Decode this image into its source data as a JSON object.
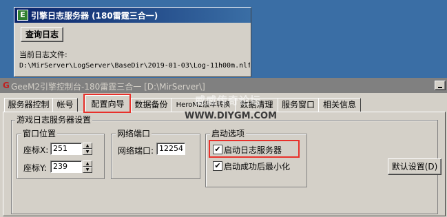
{
  "log_window": {
    "title": "引擎日志服务器 (180雷霆三合一)",
    "icon_letter": "E",
    "query_button": "查询日志",
    "current_file_label": "当前日志文件:",
    "current_file_path": "D:\\MirServer\\LogServer\\BaseDir\\2019-01-03\\Log-11h00m.nlf"
  },
  "main_window": {
    "title": "GeeM2引擎控制台-180雷霆三合一 [D:\\MirServer\\]",
    "icon_letter": "G",
    "tabs": [
      {
        "label": "服务器控制"
      },
      {
        "label": "帐号"
      },
      {
        "label": "配置向导"
      },
      {
        "label": "数据备份"
      },
      {
        "label": "HeroM2版本转换"
      },
      {
        "label": "数据清理"
      },
      {
        "label": "服务窗口"
      },
      {
        "label": "相关信息"
      }
    ],
    "active_tab": "配置向导",
    "section_title": "游戏日志服务器设置",
    "window_position": {
      "group_label": "窗口位置",
      "x_label": "座标X:",
      "x_value": "251",
      "y_label": "座标Y:",
      "y_value": "239"
    },
    "network_port": {
      "group_label": "网络端口",
      "port_label": "网络端口:",
      "port_value": "12254"
    },
    "startup_options": {
      "group_label": "启动选项",
      "opt1_label": "启动日志服务器",
      "opt1_checked": true,
      "opt2_label": "启动成功后最小化",
      "opt2_checked": true
    },
    "default_button": "默认设置(D)"
  },
  "watermark": {
    "line1": "威威传奇论坛",
    "line2": "WWW.DIYGM.COM"
  },
  "colors": {
    "highlight_box": "#e8302a",
    "desktop": "#3a6ea5",
    "face": "#d4d0c8"
  }
}
